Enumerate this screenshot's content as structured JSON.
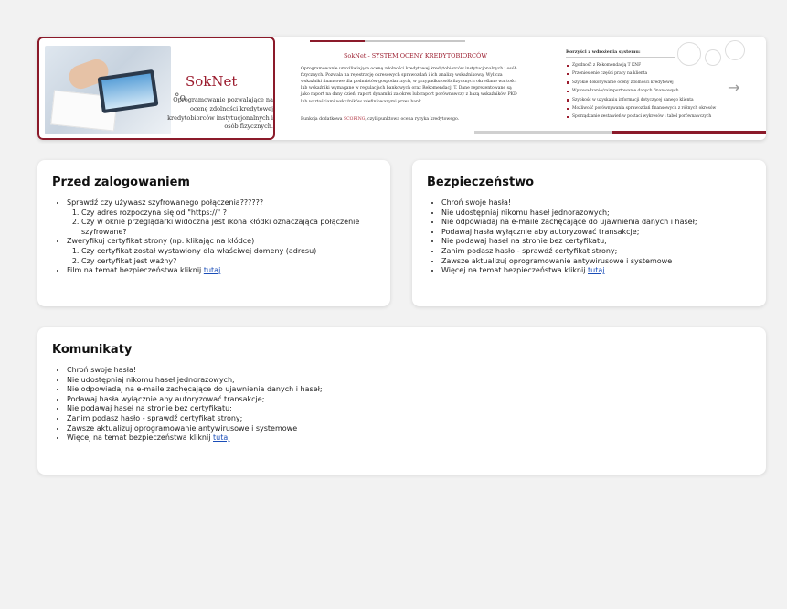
{
  "banner": {
    "left_slide": {
      "title": "SokNet",
      "description": "Oprogramowanie pozwalające na ocenę zdolności kredytowej kredytobiorców instytucjonalnych i osób fizycznych."
    },
    "mid_slide": {
      "title": "SokNet - SYSTEM OCENY KREDYTOBIORCÓW",
      "text": "Oprogramowanie umożliwiające ocenę zdolności kredytowej kredytobiorców instytucjonalnych i osób fizycznych. Pozwala na rejestrację okresowych sprawozdań i ich analizę wskaźnikową. Wylicza wskaźniki finansowe dla podmiotów gospodarczych, w przypadku osób fizycznych określane wartości lub wskaźniki wymagane w regulacjach bankowych oraz Rekomendacji T. Dane reprezentowane są jako raport na dany dzień, raport dynamiki za okres lub raport porównawczy z bazą wskaźników PKD lub wartościami wskaźników zdefiniowanymi przez bank.",
      "text2_prefix": "Funkcja dodatkowa",
      "text2_accent": "SCORING",
      "text2_suffix": ", czyli punktowa ocena ryzyka kredytowego."
    },
    "right_slide": {
      "title": "Korzyści z wdrożenia systemu:",
      "items": [
        "Zgodność z Rekomendacją T KNF",
        "Przeniesienie części pracy na klienta",
        "Szybkie dokonywanie oceny zdolności kredytowej",
        "Wprowadzanie/zaimportowanie danych finansowych",
        "Szybkość w uzyskaniu informacji dotyczącej danego klienta",
        "Możliwość porównywania sprawozdań finansowych z różnych okresów",
        "Sporządzanie zestawień w postaci wykresów i tabel porównawczych"
      ]
    },
    "next_arrow": "→"
  },
  "before_login": {
    "title": "Przed zalogowaniem",
    "item1": "Sprawdź czy używasz szyfrowanego połączenia??????",
    "item1_sub": [
      "Czy adres rozpoczyna się od \"https://\" ?",
      "Czy w oknie przeglądarki widoczna jest ikona kłódki oznaczająca połączenie szyfrowane?"
    ],
    "item2": "Zweryfikuj certyfikat strony (np. klikając na kłódce)",
    "item2_sub": [
      "Czy certyfikat został wystawiony dla właściwej domeny (adresu)",
      "Czy certyfikat jest ważny?"
    ],
    "item3_prefix": "Film na temat bezpieczeństwa kliknij ",
    "item3_link": "tutaj"
  },
  "security": {
    "title": "Bezpieczeństwo",
    "items": [
      "Chroń swoje hasła!",
      "Nie udostępniaj nikomu haseł jednorazowych;",
      "Nie odpowiadaj na e-maile zachęcające do ujawnienia danych i haseł;",
      "Podawaj hasła wyłącznie aby autoryzować transakcje;",
      "Nie podawaj haseł na stronie bez certyfikatu;",
      "Zanim podasz hasło - sprawdź certyfikat strony;",
      "Zawsze aktualizuj oprogramowanie antywirusowe i systemowe"
    ],
    "last_prefix": "Więcej na temat bezpieczeństwa kliknij ",
    "last_link": "tutaj"
  },
  "messages": {
    "title": "Komunikaty",
    "items": [
      "Chroń swoje hasła!",
      "Nie udostępniaj nikomu haseł jednorazowych;",
      "Nie odpowiadaj na e-maile zachęcające do ujawnienia danych i haseł;",
      "Podawaj hasła wyłącznie aby autoryzować transakcje;",
      "Nie podawaj haseł na stronie bez certyfikatu;",
      "Zanim podasz hasło - sprawdź certyfikat strony;",
      "Zawsze aktualizuj oprogramowanie antywirusowe i systemowe"
    ],
    "last_prefix": "Więcej na temat bezpieczeństwa kliknij ",
    "last_link": "tutaj"
  },
  "colors": {
    "accent": "#8b1a2a",
    "link": "#1a4db8",
    "background": "#f2f2f2"
  }
}
